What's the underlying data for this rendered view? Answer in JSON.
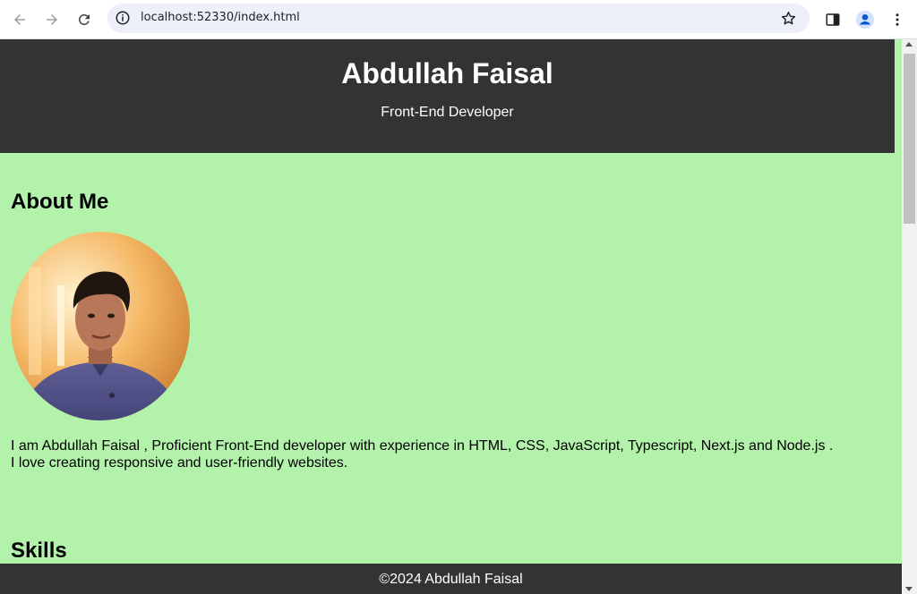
{
  "browser": {
    "url": "localhost:52330/index.html",
    "icons": [
      "back-icon",
      "forward-icon",
      "reload-icon",
      "info-icon",
      "star-icon",
      "sidebar-icon",
      "profile-icon",
      "menu-icon"
    ]
  },
  "header": {
    "title": "Abdullah Faisal",
    "subtitle": "Front-End Developer"
  },
  "about": {
    "heading": "About Me",
    "line1": "I am Abdullah Faisal , Proficient Front-End developer with experience in HTML, CSS, JavaScript, Typescript, Next.js and Node.js .",
    "line2": "I love creating responsive and user-friendly websites."
  },
  "skills": {
    "heading": "Skills"
  },
  "footer": {
    "text": "©2024 Abdullah Faisal"
  },
  "colors": {
    "page_bg": "#b2f2ab",
    "header_bg": "#333333",
    "footer_bg": "#333333",
    "omnibox_bg": "#eef0f9"
  }
}
